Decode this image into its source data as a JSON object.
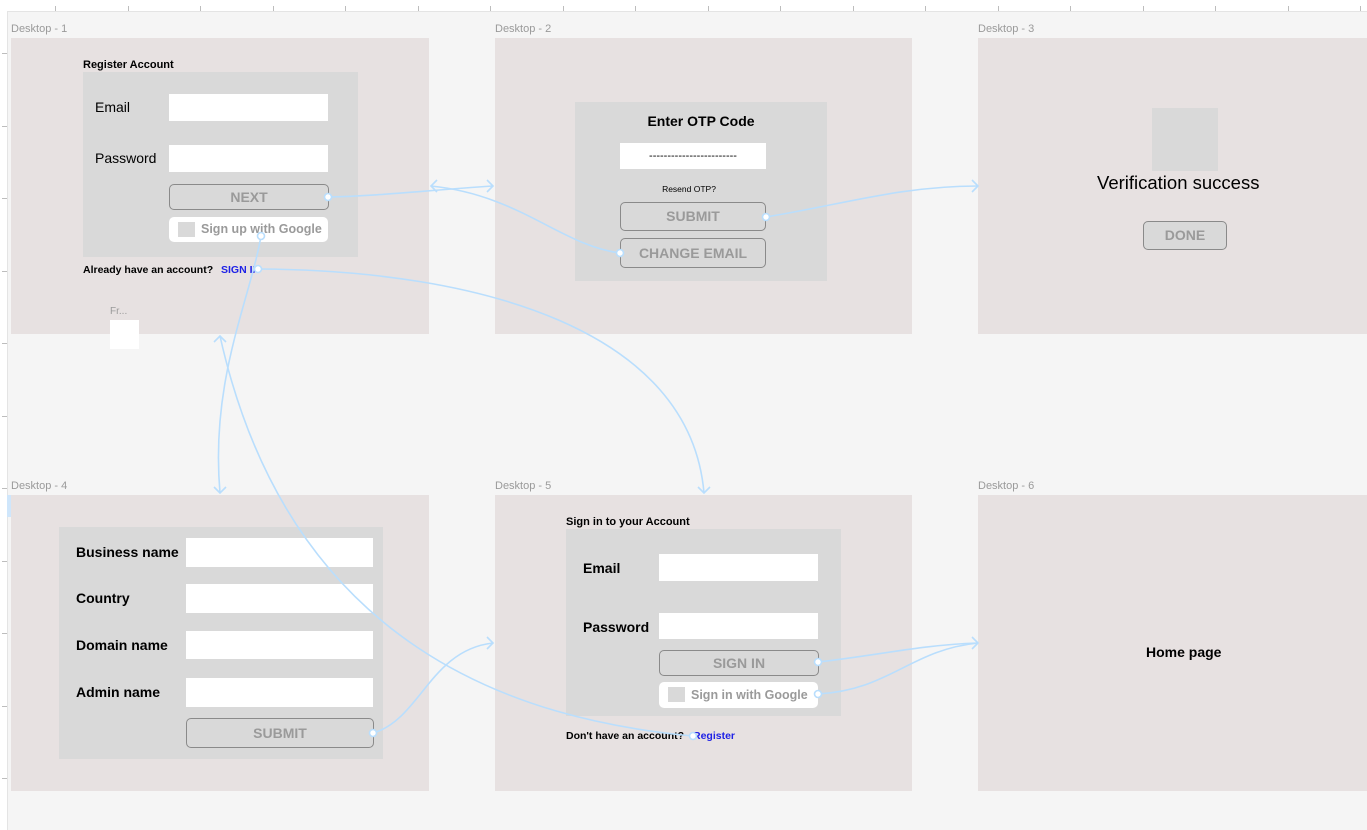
{
  "frames": {
    "desktop1": {
      "label": "Desktop - 1",
      "heading": "Register Account",
      "email_label": "Email",
      "password_label": "Password",
      "next_button": "NEXT",
      "google_button": "Sign up with Google",
      "already_text": "Already have an account?",
      "sign_in_link": "SIGN IN",
      "frame_stub_label": "Fr..."
    },
    "desktop2": {
      "label": "Desktop - 2",
      "heading": "Enter OTP Code",
      "otp_value": "------------------------",
      "resend_text": "Resend OTP?",
      "submit_button": "SUBMIT",
      "change_email_button": "CHANGE EMAIL"
    },
    "desktop3": {
      "label": "Desktop - 3",
      "message": "Verification success",
      "done_button": "DONE"
    },
    "desktop4": {
      "label": "Desktop - 4",
      "business_label": "Business name",
      "country_label": "Country",
      "domain_label": "Domain name",
      "admin_label": "Admin name",
      "submit_button": "SUBMIT"
    },
    "desktop5": {
      "label": "Desktop - 5",
      "heading": "Sign in to your Account",
      "email_label": "Email",
      "password_label": "Password",
      "signin_button": "SIGN IN",
      "google_button": "Sign in with Google",
      "no_account_text": "Don't have an account?",
      "register_link": "Register"
    },
    "desktop6": {
      "label": "Desktop - 6",
      "title": "Home page"
    }
  },
  "colors": {
    "canvas": "#f5f5f5",
    "frame": "#e7e1e1",
    "panel": "#d9d9d9",
    "field": "#ffffff",
    "button_text": "#9a9a9a",
    "link": "#1f22e6",
    "connector": "#b9defd"
  }
}
